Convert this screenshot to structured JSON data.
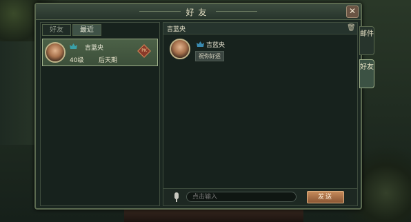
{
  "window": {
    "title": "好友",
    "close_glyph": "✕"
  },
  "tabs": [
    {
      "label": "好友",
      "active": false
    },
    {
      "label": "最近",
      "active": true
    }
  ],
  "contacts": [
    {
      "name": "吉蓝央",
      "level": "40级",
      "realm": "后天期",
      "vip_icon": "vip-crown-icon",
      "badge": "PK"
    }
  ],
  "chat": {
    "title": "吉蓝央",
    "messages": [
      {
        "sender": "吉蓝央",
        "text": "祝你好运"
      }
    ],
    "input_placeholder": "点击输入",
    "send_label": "发送"
  },
  "side_tabs": [
    {
      "label": "邮件",
      "active": false
    },
    {
      "label": "好友",
      "active": true
    }
  ],
  "colors": {
    "accent": "#3f5247",
    "send_button": "#c58a5a"
  }
}
